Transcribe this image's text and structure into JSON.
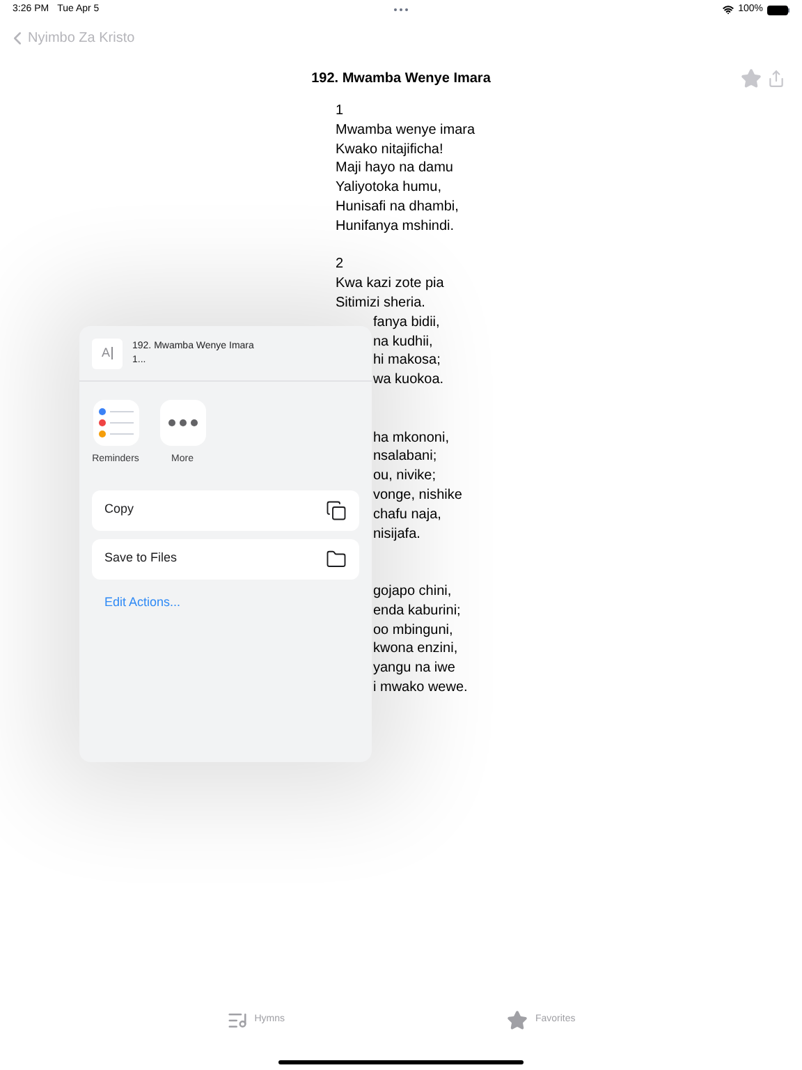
{
  "status_bar": {
    "time": "3:26 PM",
    "date": "Tue Apr 5",
    "battery": "100%"
  },
  "nav": {
    "back": "Nyimbo Za Kristo",
    "title": "192. Mwamba Wenye Imara"
  },
  "verses": [
    {
      "number": "1",
      "lines": [
        {
          "kind": "full",
          "text": "Mwamba wenye imara"
        },
        {
          "kind": "full",
          "text": "Kwako nitajificha!"
        },
        {
          "kind": "full",
          "text": "Maji hayo na damu"
        },
        {
          "kind": "full",
          "text": "Yaliyotoka humu,"
        },
        {
          "kind": "full",
          "text": "Hunisafi na dhambi,"
        },
        {
          "kind": "full",
          "text": "Hunifanya mshindi."
        }
      ]
    },
    {
      "number": "2",
      "lines": [
        {
          "kind": "full",
          "text": "Kwa kazi zote pia"
        },
        {
          "kind": "full",
          "text": "Sitimizi sheria."
        },
        {
          "kind": "partial",
          "text": "fanya bidii,"
        },
        {
          "kind": "partial",
          "text": "na kudhii,"
        },
        {
          "kind": "partial",
          "text": "hi makosa;"
        },
        {
          "kind": "partial",
          "text": "wa kuokoa."
        }
      ]
    },
    {
      "lines": [
        {
          "kind": "partial",
          "text": "ha mkononi,"
        },
        {
          "kind": "partial",
          "text": "nsalabani;"
        },
        {
          "kind": "partial",
          "text": "ou, nivike;"
        },
        {
          "kind": "partial",
          "text": "vonge, nishike"
        },
        {
          "kind": "partial",
          "text": "chafu naja,"
        },
        {
          "kind": "partial",
          "text": "nisijafa."
        }
      ]
    },
    {
      "lines": [
        {
          "kind": "partial",
          "text": "gojapo chini,"
        },
        {
          "kind": "partial",
          "text": "enda kaburini;"
        },
        {
          "kind": "partial",
          "text": "oo mbinguni,"
        },
        {
          "kind": "partial",
          "text": "kwona enzini,"
        },
        {
          "kind": "partial",
          "text": "yangu na iwe"
        },
        {
          "kind": "partial",
          "text": "i mwako wewe."
        }
      ]
    }
  ],
  "share_sheet": {
    "preview": {
      "glyph": "A",
      "title": "192. Mwamba Wenye Imara",
      "subtitle": "1..."
    },
    "apps": [
      {
        "kind": "reminders",
        "label": "Reminders"
      },
      {
        "kind": "more",
        "label": "More"
      }
    ],
    "actions": [
      {
        "kind": "copy",
        "label": "Copy"
      },
      {
        "kind": "folder",
        "label": "Save to Files"
      }
    ],
    "edit_link": "Edit Actions..."
  },
  "tab_bar": [
    {
      "kind": "hymns",
      "label": "Hymns"
    },
    {
      "kind": "favorites",
      "label": "Favorites"
    }
  ]
}
